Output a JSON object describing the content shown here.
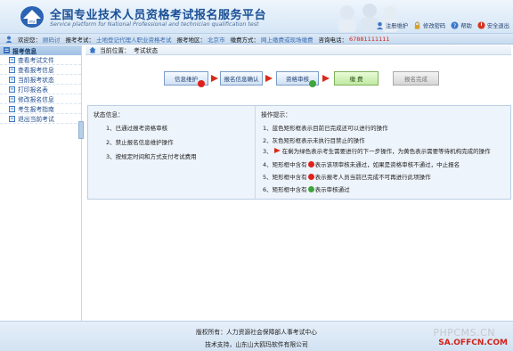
{
  "header": {
    "title": "全国专业技术人员资格考试报名服务平台",
    "subtitle": "Service platform for National Professional and technician qualification test",
    "links": [
      {
        "label": "注册维护",
        "icon": "user-icon"
      },
      {
        "label": "修改密码",
        "icon": "lock-icon"
      },
      {
        "label": "帮助",
        "icon": "help-icon"
      },
      {
        "label": "安全退出",
        "icon": "exit-icon"
      }
    ]
  },
  "infobar": {
    "welcome_label": "欢迎您：",
    "welcome_value": "顾码讨",
    "exam_label": "报考考试：",
    "exam_value": "土地登记代理人职业资格考试",
    "region_label": "报考地区：",
    "region_value": "北京市",
    "fee_label": "缴费方式：",
    "fee_value": "网上缴费或现场缴费",
    "phone_label": "咨询电话：",
    "phone_value": "67881111111"
  },
  "sidebar": {
    "title": "报考信息",
    "items": [
      {
        "label": "查看考试文件"
      },
      {
        "label": "查看报考信息"
      },
      {
        "label": "当前报考状态"
      },
      {
        "label": "打印报名表"
      },
      {
        "label": "修改报名信息"
      },
      {
        "label": "考生报考指南"
      },
      {
        "label": "退出当前考试"
      }
    ]
  },
  "breadcrumb": {
    "label": "当前位置：",
    "value": "考试状态"
  },
  "steps": [
    {
      "label": "信息维护"
    },
    {
      "label": "报名信息确认"
    },
    {
      "label": "资格审核"
    },
    {
      "label": "缴  费"
    },
    {
      "label": "报名完成"
    }
  ],
  "panel": {
    "left_title": "状态信息：",
    "left_rows": [
      "1、已通过报考资格审核",
      "2、禁止报名信息维护操作",
      "3、按规定时间和方式支付考试费用"
    ],
    "right_title": "操作提示：",
    "right_rows": {
      "r1": "1、蓝色矩形框表示目前已完成还可以进行的操作",
      "r2": "2、灰色矩形框表示未执行目禁止的操作",
      "r3a": "3、",
      "r3b": "在剩为绿色表示考生需要进行的下一步操作，为黄色表示需要等待机构完成的操作",
      "r4a": "4、矩形框中含有",
      "r4b": "表示该项审核未通过，如果是资格审核不通过，中止报名",
      "r5a": "5、矩形框中含有",
      "r5b": "表示报考人员当前已完成不可再进行此项操作",
      "r6a": "6、矩形框中含有",
      "r6b": "表示审核通过"
    }
  },
  "footer": {
    "line1": "版权所有：人力资源社会保障部人事考试中心",
    "line2": "技术支持，山东山大鸥玛软件有限公司"
  },
  "watermark": {
    "line1": "PHPCMS.CN",
    "line2": "SA.OFFCN.COM"
  }
}
